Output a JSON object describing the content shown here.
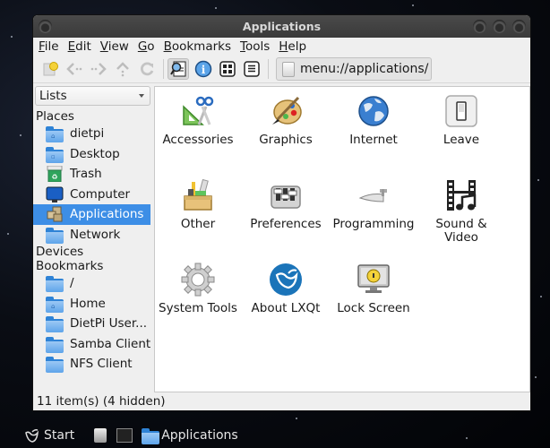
{
  "window": {
    "title": "Applications"
  },
  "menubar": [
    "File",
    "Edit",
    "View",
    "Go",
    "Bookmarks",
    "Tools",
    "Help"
  ],
  "toolbar": {
    "buttons": [
      "new-tab-icon",
      "back-icon",
      "forward-icon",
      "up-icon",
      "reload-icon",
      "detailed-view-icon",
      "info-icon",
      "icon-view-icon",
      "list-view-icon"
    ],
    "address": "menu://applications/"
  },
  "sidebar": {
    "mode": "Lists",
    "places_header": "Places",
    "places": [
      {
        "label": "dietpi",
        "icon": "home-folder-icon"
      },
      {
        "label": "Desktop",
        "icon": "desktop-folder-icon"
      },
      {
        "label": "Trash",
        "icon": "trash-icon"
      },
      {
        "label": "Computer",
        "icon": "computer-icon"
      },
      {
        "label": "Applications",
        "icon": "applications-icon",
        "selected": true
      },
      {
        "label": "Network",
        "icon": "network-folder-icon"
      }
    ],
    "devices_header": "Devices",
    "bookmarks_header": "Bookmarks",
    "bookmarks": [
      {
        "label": "/",
        "icon": "folder-icon"
      },
      {
        "label": "Home",
        "icon": "home-folder-icon"
      },
      {
        "label": "DietPi User...",
        "icon": "folder-icon"
      },
      {
        "label": "Samba Client",
        "icon": "folder-icon"
      },
      {
        "label": "NFS Client",
        "icon": "folder-icon"
      }
    ]
  },
  "apps": [
    {
      "label": "Accessories",
      "icon": "accessories-icon"
    },
    {
      "label": "Graphics",
      "icon": "graphics-icon"
    },
    {
      "label": "Internet",
      "icon": "internet-icon"
    },
    {
      "label": "Leave",
      "icon": "leave-icon"
    },
    {
      "label": "Other",
      "icon": "other-icon"
    },
    {
      "label": "Preferences",
      "icon": "preferences-icon"
    },
    {
      "label": "Programming",
      "icon": "programming-icon"
    },
    {
      "label": "Sound & Video",
      "icon": "sound-video-icon"
    },
    {
      "label": "System Tools",
      "icon": "system-tools-icon"
    },
    {
      "label": "About LXQt",
      "icon": "about-lxqt-icon"
    },
    {
      "label": "Lock Screen",
      "icon": "lock-screen-icon"
    }
  ],
  "status": "11 item(s) (4 hidden)",
  "taskbar": {
    "start_label": "Start",
    "task_label": "Applications"
  }
}
